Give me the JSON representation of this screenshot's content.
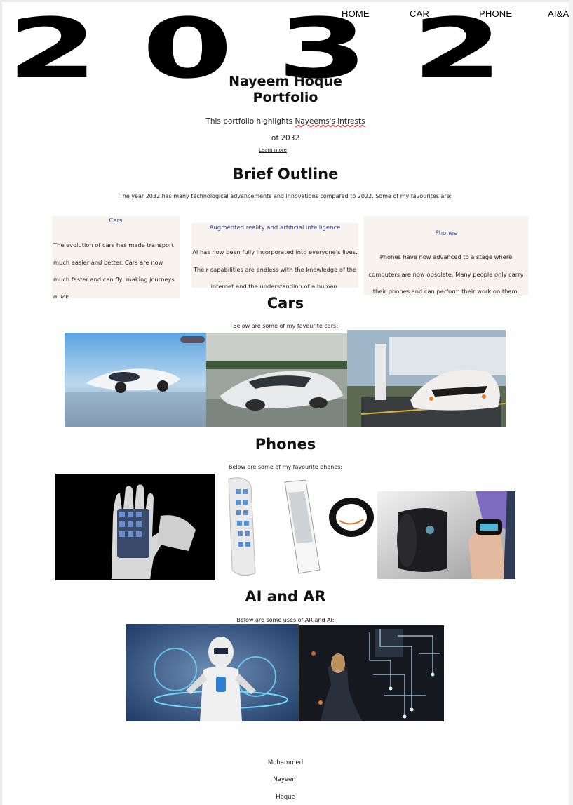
{
  "nav": {
    "home": "HOME",
    "car": "CAR",
    "phone": "PHONE",
    "aiar": "AI&A"
  },
  "logo": {
    "text": "2032"
  },
  "hero": {
    "title_line1": "Nayeem Hoque",
    "title_line2": "Portfolio",
    "desc_pre": "This portfolio highlights ",
    "desc_squiggle": "Nayeems's intrests",
    "desc_post": " of 2032",
    "learn_more": "Learn more"
  },
  "outline": {
    "title": "Brief Outline",
    "intro": "The year 2032 has many technological advancements and innovations compared to 2022. Some of my favourites are:",
    "cards": [
      {
        "title": "Cars",
        "body": "The evolution of cars has made transport much easier and better. Cars are now much faster and can fly, making journeys quick."
      },
      {
        "title": "Augmented reality and artificial intelligence",
        "body": "AI has now been fully incorporated into everyone's lives. Their capabilities are endless with the knowledge of the internet and the understanding of a human."
      },
      {
        "title": "Phones",
        "body": "Phones have now advanced to a stage where computers are now obsolete. Many people only carry their phones and can perform their work on them."
      }
    ]
  },
  "cars": {
    "title": "Cars",
    "subtitle": "Below are some of my favourite cars:"
  },
  "phones": {
    "title": "Phones",
    "subtitle": "Below are some of my favourite phones:"
  },
  "aiar": {
    "title": "AI and AR",
    "subtitle": "Below are some uses of AR and AI:"
  },
  "footer": {
    "line1": "Mohammed",
    "line2": "Nayeem",
    "line3": "Hoque"
  },
  "colors": {
    "card_bg": "#f9f3ef",
    "card_title": "#3b4a86",
    "squiggle": "#dd3333"
  }
}
